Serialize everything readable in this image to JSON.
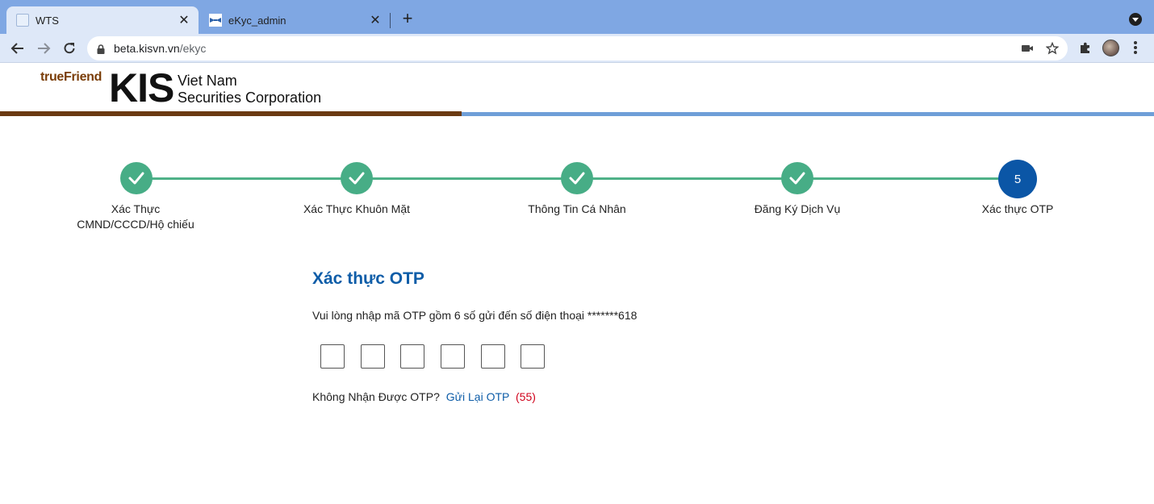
{
  "browser": {
    "tabs": [
      {
        "title": "WTS",
        "active": true
      },
      {
        "title": "eKyc_admin",
        "active": false
      }
    ],
    "url": {
      "host": "beta.kisvn.vn",
      "path": "/ekyc"
    }
  },
  "header": {
    "logo_brand": "trueFriend",
    "logo_name": "KIS",
    "logo_sub_line1": "Viet Nam",
    "logo_sub_line2": "Securities Corporation"
  },
  "stepper": {
    "steps": [
      {
        "label_line1": "Xác Thực",
        "label_line2": "CMND/CCCD/Hộ chiếu",
        "status": "done"
      },
      {
        "label_line1": "Xác Thực Khuôn Mặt",
        "label_line2": "",
        "status": "done"
      },
      {
        "label_line1": "Thông Tin Cá Nhân",
        "label_line2": "",
        "status": "done"
      },
      {
        "label_line1": "Đăng Ký Dịch Vụ",
        "label_line2": "",
        "status": "done"
      },
      {
        "label_line1": "Xác thực OTP",
        "label_line2": "",
        "status": "current",
        "number": "5"
      }
    ]
  },
  "otp": {
    "title": "Xác thực OTP",
    "description": "Vui lòng nhập mã OTP gồm 6 số gửi đến số điện thoại *******618",
    "digits": [
      "",
      "",
      "",
      "",
      "",
      ""
    ],
    "resend_prompt": "Không Nhận Được OTP?",
    "resend_link": "Gửi Lại OTP",
    "countdown": "(55)"
  },
  "colors": {
    "step_done": "#47ad86",
    "step_current": "#0b56a6",
    "title_blue": "#0e5da8",
    "countdown_red": "#d0021b"
  }
}
